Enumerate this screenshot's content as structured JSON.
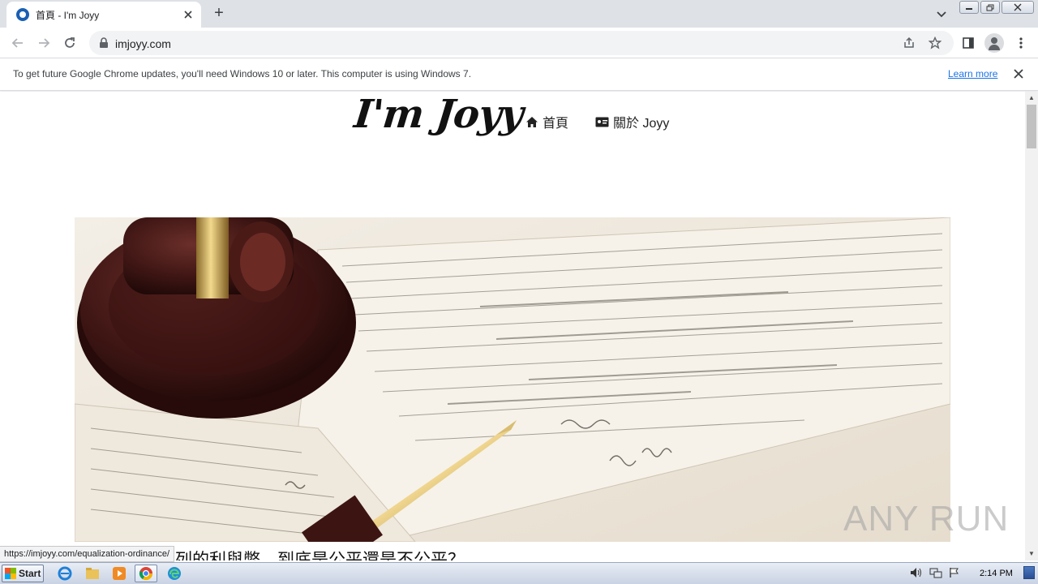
{
  "browser": {
    "tab": {
      "title": "首頁 - I'm Joyy"
    },
    "new_tab_label": "+",
    "url": "imjoyy.com",
    "infobar": {
      "message": "To get future Google Chrome updates, you'll need Windows 10 or later. This computer is using Windows 7.",
      "link": "Learn more"
    },
    "status_url": "https://imjoyy.com/equalization-ordinance/"
  },
  "site": {
    "logo": "I'm Joyy",
    "nav": [
      {
        "label": "首頁",
        "icon": "home-icon"
      },
      {
        "label": "關於 Joyy",
        "icon": "id-card-icon"
      }
    ],
    "article": {
      "title": "列的利與弊，到底是公平還是不公平？"
    },
    "watermark": "ANY RUN"
  },
  "taskbar": {
    "start_label": "Start",
    "apps": [
      "internet-explorer-icon",
      "file-explorer-icon",
      "media-player-icon",
      "chrome-icon",
      "edge-icon"
    ],
    "clock": "2:14 PM"
  },
  "colors": {
    "tabstrip": "#dee1e6",
    "link": "#1a73e8",
    "taskbar": "#c9d3e3"
  }
}
